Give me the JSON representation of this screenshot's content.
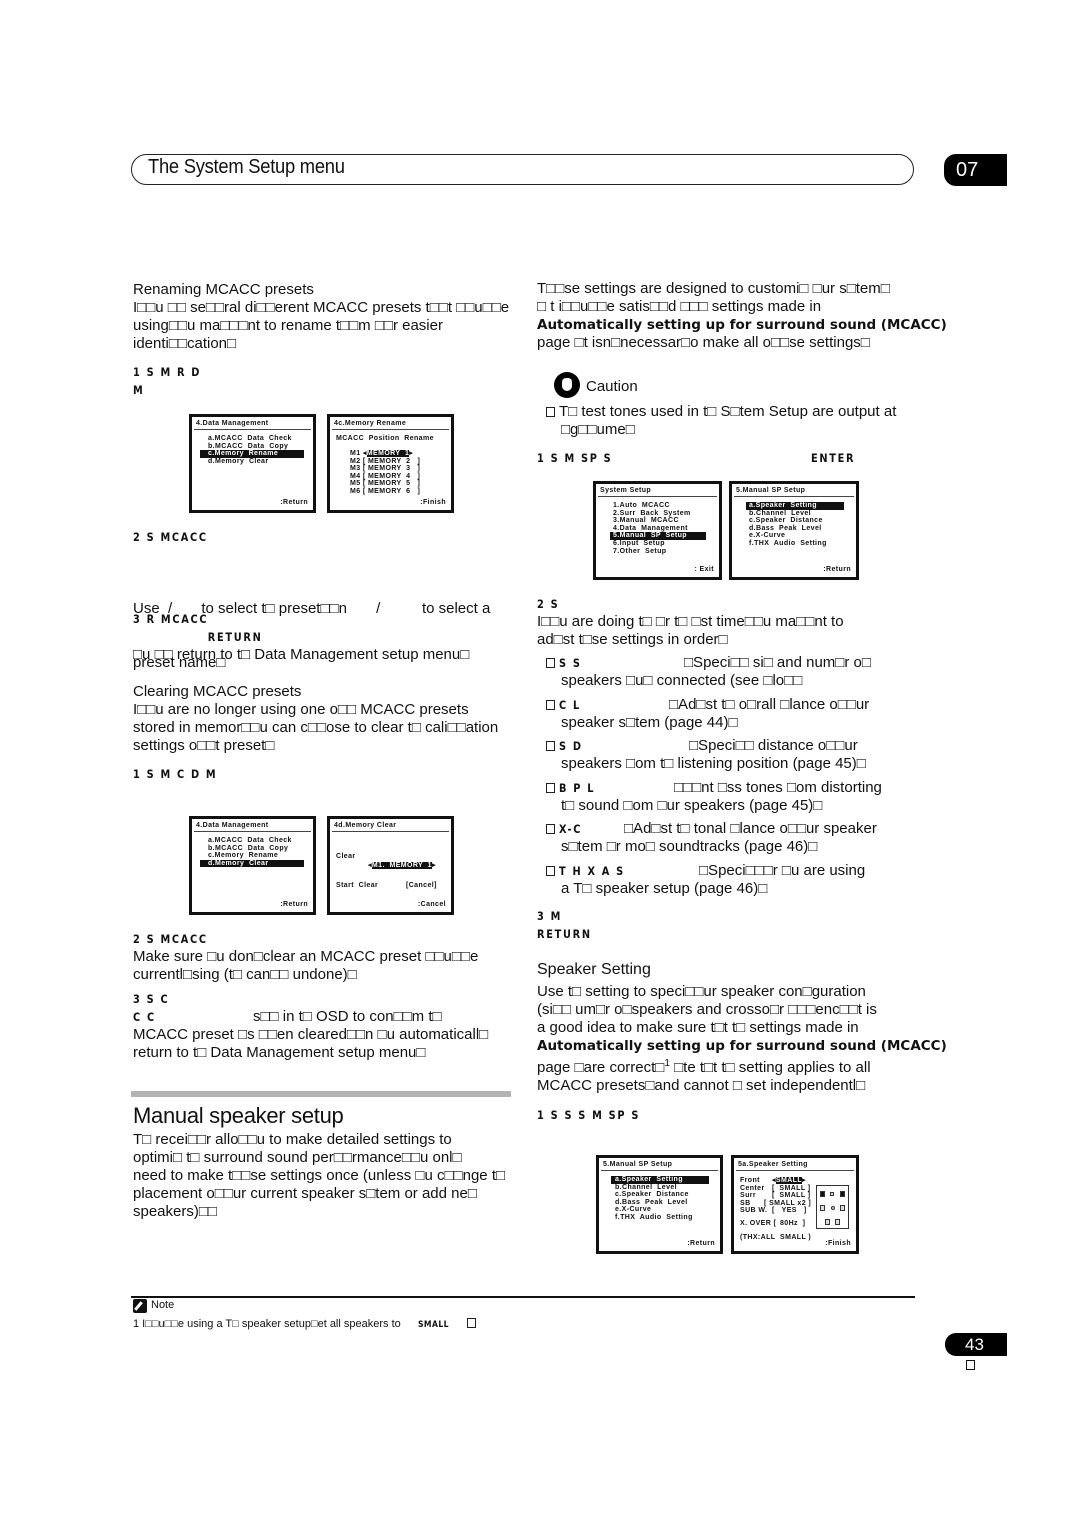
{
  "header": {
    "title": "The System Setup menu",
    "chapter": "07"
  },
  "left": {
    "renaming": {
      "heading": "Renaming MCACC presets",
      "intro": [
        "I□□u □□ se□□ral di□□erent MCACC presets t□□t □□u□□e",
        "using□□u ma□□□nt to rename t□□m □□r easier",
        "identi□□cation□"
      ],
      "step1": [
        "1    S M R  D",
        "M"
      ],
      "osd_left": {
        "title": "4.Data  Management",
        "items": [
          "a.MCACC  Data  Check",
          "b.MCACC  Data  Copy",
          "c.Memory  Rename",
          "d.Memory  Clear"
        ],
        "selected_index": 2,
        "footer": ":Return"
      },
      "osd_right": {
        "title": "4c.Memory  Rename",
        "subtitle": "MCACC  Position  Rename",
        "rows": [
          {
            "pos": "M1",
            "name": "MEMORY  1"
          },
          {
            "pos": "M2",
            "name": "MEMORY  2"
          },
          {
            "pos": "M3",
            "name": "MEMORY  3"
          },
          {
            "pos": "M4",
            "name": "MEMORY  4"
          },
          {
            "pos": "M5",
            "name": "MEMORY  5"
          },
          {
            "pos": "M6",
            "name": "MEMORY  6"
          }
        ],
        "selected_index": 0,
        "footer": ":Finish"
      },
      "step2": "2    S MCACC",
      "step2_text": [
        "Use  /       to select t□ preset□□n       /          to select a",
        "preset name□"
      ],
      "step3": [
        "3    R  MCACC",
        "RETURN"
      ],
      "step3_text": "□u □□ return to t□ Data Management setup menu□"
    },
    "clearing": {
      "heading": "Clearing MCACC presets",
      "intro": [
        "I□□u are no longer using one o□□ MCACC presets",
        "stored in memor□□u can c□□ose to clear t□ cali□□ation",
        "settings o□□t preset□"
      ],
      "step1": "1    S M C  D M",
      "osd_left": {
        "title": "4.Data  Management",
        "items": [
          "a.MCACC  Data  Check",
          "b.MCACC  Data  Copy",
          "c.Memory  Rename",
          "d.Memory  Clear"
        ],
        "selected_index": 3,
        "footer": ":Return"
      },
      "osd_right": {
        "title": "4d.Memory  Clear",
        "clear_label": "Clear",
        "clear_value": "M1.  MEMORY  1",
        "start_label": "Start  Clear",
        "start_value": "[Cancel]",
        "footer": ":Cancel"
      },
      "step2": "2    S MCACC",
      "step2_text": [
        "Make sure □u don□clear an MCACC preset □□u□□e",
        "currentl□sing (t□ can□□ undone)□"
      ],
      "step3": [
        "3    S C",
        "C C"
      ],
      "step3_text": [
        "s□□ in t□ OSD to con□□m t□",
        "MCACC preset □s □□en cleared□□n □u automaticall□",
        "return to t□ Data Management setup menu□"
      ]
    },
    "manual": {
      "heading": "Manual speaker setup",
      "text": [
        "T□ recei□□r allo□□u to make detailed settings to",
        "optimi□ t□ surround sound per□□rmance□□u onl□",
        "need to make t□□se settings once (unless □u c□□nge t□",
        "placement o□□ur current speaker s□tem or add ne□",
        "speakers)□□"
      ]
    }
  },
  "right": {
    "intro": [
      "T□□se settings are designed to customi□ □ur s□tem□",
      "□ t i□□u□□e satis□□d □□□ settings made in"
    ],
    "bold_link": "Automatically setting up for surround sound (MCACC)",
    "intro_tail": "page □t isn□necessar□o make all o□□se settings□",
    "caution_label": "Caution",
    "caution_text": [
      "T□ test tones used in t□ S□tem Setup are output at",
      "□g□□ume□"
    ],
    "step1": "1    S M SP S",
    "step1_key": "ENTER",
    "osd_system": {
      "title": "System  Setup",
      "items": [
        "1.Auto  MCACC",
        "2.Surr  Back  System",
        "3.Manual  MCACC",
        "4.Data  Management",
        "5.Manual  SP  Setup",
        "6.Input  Setup",
        "7.Other  Setup"
      ],
      "selected_index": 4,
      "footer": ": Exit"
    },
    "osd_manual": {
      "title": "5.Manual  SP  Setup",
      "items": [
        "a.Speaker  Setting",
        "b.Channel  Level",
        "c.Speaker  Distance",
        "d.Bass  Peak  Level",
        "e.X-Curve",
        "f.THX  Audio  Setting"
      ],
      "selected_index": 0,
      "footer": ":Return"
    },
    "step2": "2    S",
    "step2_text": [
      "I□□u are doing t□ □r t□ □st time□□u ma□□nt to",
      "ad□st t□se settings in order□"
    ],
    "bullets": [
      {
        "key": "S S",
        "line1": "□Speci□□ si□ and num□r o□",
        "line2": "speakers □u□ connected (see □lo□□"
      },
      {
        "key": "C L",
        "line1": "□Ad□st t□ o□rall □lance o□□ur",
        "line2": "speaker s□tem (page 44)□"
      },
      {
        "key": "S D",
        "line1": "□Speci□□ distance o□□ur",
        "line2": "speakers □om t□ listening position (page 45)□"
      },
      {
        "key": "B P L",
        "line1": "□□□nt □ss tones □om distorting",
        "line2": "t□ sound □om □ur speakers (page 45)□"
      },
      {
        "key": "X-C",
        "line1": "□Ad□st t□ tonal □lance o□□ur speaker",
        "line2": "s□tem □r mo□ soundtracks (page 46)□"
      },
      {
        "key": "T H X A S",
        "line1": "□Speci□□□r □u are using",
        "line2": "a T□ speaker setup (page 46)□"
      }
    ],
    "step3": [
      "3    M",
      "RETURN"
    ],
    "speaker_setting": {
      "heading": "Speaker Setting",
      "text": [
        "Use t□ setting to speci□□ur speaker con□guration",
        "(si□□ um□r o□speakers and crosso□r □□□enc□□t is",
        "a good idea to make sure t□t t□ settings made in"
      ],
      "bold_link": "Automatically setting up for surround sound (MCACC)",
      "tail": [
        "page □are correct□",
        "□te t□t t□ setting applies to all",
        "MCACC presets□and cannot □ set independentl□"
      ],
      "footnote_ref": "1",
      "step1": "1    S S S  M SP S"
    },
    "osd_manual2": {
      "title": "5.Manual  SP  Setup",
      "items": [
        "a.Speaker  Setting",
        "b.Channel  Level",
        "c.Speaker  Distance",
        "d.Bass  Peak  Level",
        "e.X-Curve",
        "f.THX  Audio  Setting"
      ],
      "selected_index": 0,
      "footer": ":Return"
    },
    "osd_speaker": {
      "title": "5a.Speaker  Setting",
      "rows": [
        {
          "label": "Front",
          "value": "SMALL"
        },
        {
          "label": "Center",
          "value": "[  SMALL ]"
        },
        {
          "label": "Surr",
          "value": "[  SMALL ]"
        },
        {
          "label": "SB",
          "value": "[ SMALL x2 ]"
        },
        {
          "label": "SUB W.",
          "value": "[   YES   ]"
        }
      ],
      "xover_label": "X. OVER [",
      "xover_value": "80Hz  ]",
      "thx_note": "(THX:ALL  SMALL )",
      "footer": ":Finish"
    }
  },
  "footer": {
    "note_label": "Note",
    "note_text": "1 I□□u□□e using a T□ speaker setup□et all speakers to",
    "note_key": "SMALL",
    "page_number": "43"
  }
}
